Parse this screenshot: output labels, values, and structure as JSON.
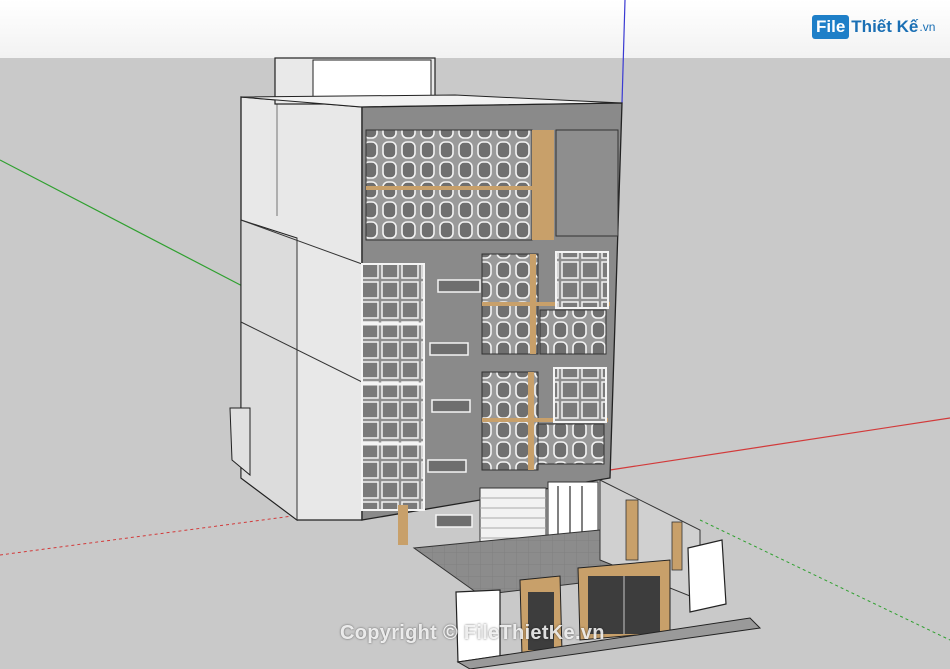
{
  "watermark": {
    "logo_file": "File",
    "logo_rest": "Thiết Kế",
    "logo_tld": ".vn",
    "copyright": "Copyright © FileThietKe.vn"
  },
  "colors": {
    "sky": "#ffffff",
    "ground": "#c9c9c9",
    "facade": "#8a8a8a",
    "side_wall": "#e6e6e6",
    "wood": "#c8a06a",
    "glass": "#9a9a9a",
    "axis_red": "#d23a3a",
    "axis_green": "#2fa02f",
    "axis_blue": "#3a3ad2",
    "logo_blue": "#1e7fc8"
  },
  "icons": [
    "cube-icon"
  ]
}
